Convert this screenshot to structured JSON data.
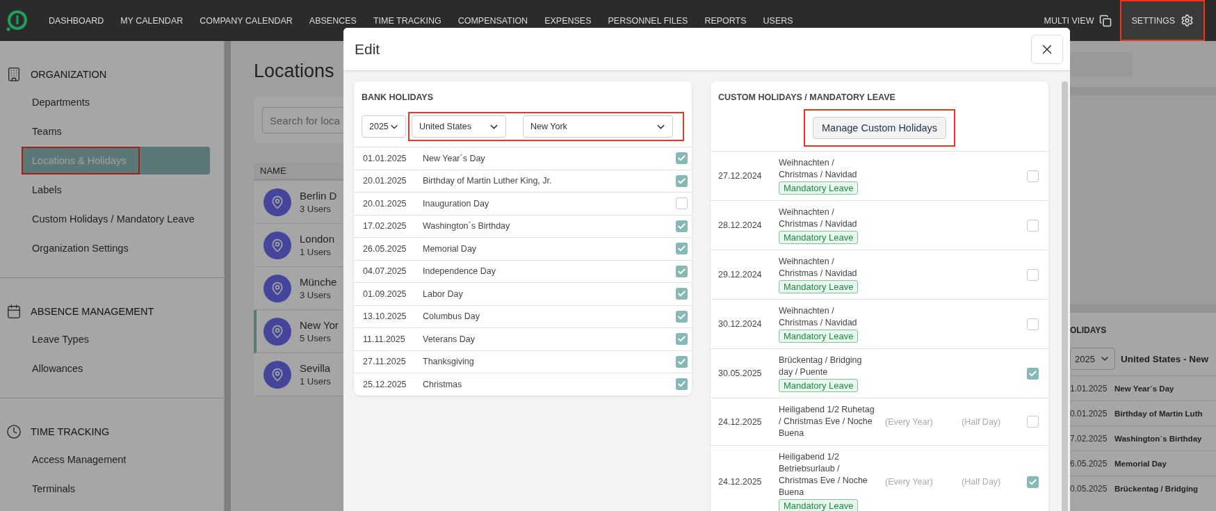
{
  "nav": {
    "items": [
      "DASHBOARD",
      "MY CALENDAR",
      "COMPANY CALENDAR",
      "ABSENCES",
      "TIME TRACKING",
      "COMPENSATION",
      "EXPENSES",
      "PERSONNEL FILES",
      "REPORTS",
      "USERS"
    ],
    "multi_view": "MULTI VIEW",
    "settings": "SETTINGS",
    "settings_highlighted": true
  },
  "sidebar": {
    "sections": [
      {
        "title": "ORGANIZATION",
        "kind": "building",
        "items": [
          {
            "label": "Departments",
            "selected": false,
            "highlighted": false
          },
          {
            "label": "Teams",
            "selected": false,
            "highlighted": false
          },
          {
            "label": "Locations & Holidays",
            "selected": true,
            "highlighted": true
          },
          {
            "label": "Labels",
            "selected": false,
            "highlighted": false
          },
          {
            "label": "Custom Holidays / Mandatory Leave",
            "selected": false,
            "highlighted": false
          },
          {
            "label": "Organization Settings",
            "selected": false,
            "highlighted": false
          }
        ]
      },
      {
        "title": "ABSENCE MANAGEMENT",
        "kind": "calendar",
        "items": [
          {
            "label": "Leave Types",
            "selected": false,
            "highlighted": false
          },
          {
            "label": "Allowances",
            "selected": false,
            "highlighted": false
          }
        ]
      },
      {
        "title": "TIME TRACKING",
        "kind": "clock",
        "items": [
          {
            "label": "Access Management",
            "selected": false,
            "highlighted": false
          },
          {
            "label": "Terminals",
            "selected": false,
            "highlighted": false
          }
        ]
      }
    ]
  },
  "locations": {
    "title": "Locations",
    "search": {
      "placeholder": "Search for loca"
    },
    "column": "NAME",
    "rows": [
      {
        "name": "Berlin D",
        "users": "3 Users",
        "selected": false
      },
      {
        "name": "London",
        "users": "1 Users",
        "selected": false
      },
      {
        "name": "Münche",
        "users": "3 Users",
        "selected": false
      },
      {
        "name": "New Yor",
        "users": "5 Users",
        "selected": true
      },
      {
        "name": "Sevilla",
        "users": "1 Users",
        "selected": false
      }
    ]
  },
  "background_holidays": {
    "title": "OLIDAYS",
    "year": "2025",
    "region": "United States - New",
    "rows": [
      {
        "date": "1.01.2025",
        "name": "New Year´s Day"
      },
      {
        "date": "0.01.2025",
        "name": "Birthday of Martin Luth"
      },
      {
        "date": "7.02.2025",
        "name": "Washington´s Birthday"
      },
      {
        "date": "6.05.2025",
        "name": "Memorial Day"
      },
      {
        "date": "0.05.2025",
        "name": "Brückentag / Bridging"
      }
    ]
  },
  "modal": {
    "title": "Edit",
    "bank_holidays": {
      "title": "BANK HOLIDAYS",
      "year": "2025",
      "country": "United States",
      "region": "New York",
      "selects_highlighted": true,
      "rows": [
        {
          "date": "01.01.2025",
          "name": "New Year´s Day",
          "checked": true
        },
        {
          "date": "20.01.2025",
          "name": "Birthday of Martin Luther King, Jr.",
          "checked": true
        },
        {
          "date": "20.01.2025",
          "name": "Inauguration Day",
          "checked": false
        },
        {
          "date": "17.02.2025",
          "name": "Washington´s Birthday",
          "checked": true
        },
        {
          "date": "26.05.2025",
          "name": "Memorial Day",
          "checked": true
        },
        {
          "date": "04.07.2025",
          "name": "Independence Day",
          "checked": true
        },
        {
          "date": "01.09.2025",
          "name": "Labor Day",
          "checked": true
        },
        {
          "date": "13.10.2025",
          "name": "Columbus Day",
          "checked": true
        },
        {
          "date": "11.11.2025",
          "name": "Veterans Day",
          "checked": true
        },
        {
          "date": "27.11.2025",
          "name": "Thanksgiving",
          "checked": true
        },
        {
          "date": "25.12.2025",
          "name": "Christmas",
          "checked": true
        }
      ]
    },
    "custom_holidays": {
      "title": "CUSTOM HOLIDAYS / MANDATORY LEAVE",
      "button": "Manage Custom Holidays",
      "button_highlighted": true,
      "rows": [
        {
          "date": "27.12.2024",
          "name": "Weihnachten / Christmas / Navidad",
          "tag": "Mandatory Leave",
          "checked": false
        },
        {
          "date": "28.12.2024",
          "name": "Weihnachten / Christmas / Navidad",
          "tag": "Mandatory Leave",
          "checked": false
        },
        {
          "date": "29.12.2024",
          "name": "Weihnachten / Christmas / Navidad",
          "tag": "Mandatory Leave",
          "checked": false
        },
        {
          "date": "30.12.2024",
          "name": "Weihnachten / Christmas / Navidad",
          "tag": "Mandatory Leave",
          "checked": false
        },
        {
          "date": "30.05.2025",
          "name": "Brückentag / Bridging day / Puente",
          "tag": "Mandatory Leave",
          "checked": true
        },
        {
          "date": "24.12.2025",
          "name": "Heiligabend 1/2 Ruhetag / Christmas Eve / Noche Buena",
          "recurrence": "(Every Year)",
          "duration": "(Half Day)",
          "checked": false
        },
        {
          "date": "24.12.2025",
          "name": "Heiligabend 1/2 Betriebsurlaub / Christmas Eve / Noche Buena",
          "recurrence": "(Every Year)",
          "duration": "(Half Day)",
          "tag": "Mandatory Leave",
          "checked": true
        }
      ]
    }
  }
}
